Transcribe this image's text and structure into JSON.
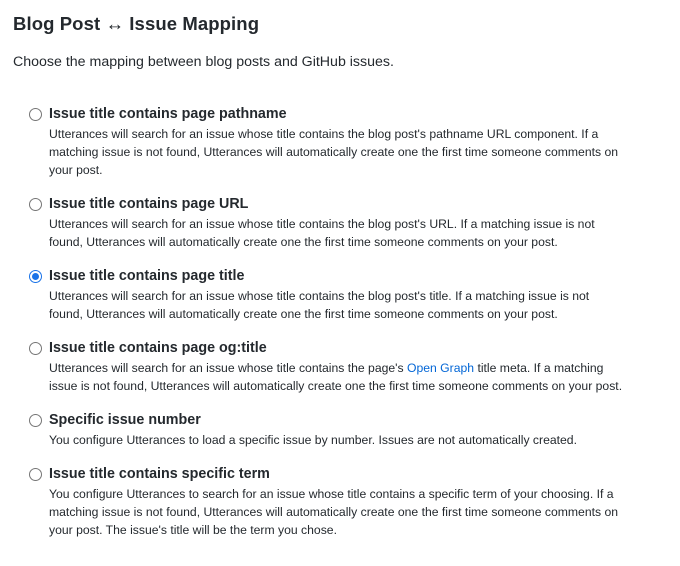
{
  "section": {
    "title": "Blog Post ↔ Issue Mapping",
    "description": "Choose the mapping between blog posts and GitHub issues."
  },
  "options": [
    {
      "label": "Issue title contains page pathname",
      "checked": false,
      "help_lines": [
        "Utterances will search for an issue whose title contains the blog post's pathname URL component. If a",
        "matching issue is not found, Utterances will automatically create one the first time someone comments on",
        "your post."
      ]
    },
    {
      "label": "Issue title contains page URL",
      "checked": false,
      "help_lines": [
        "Utterances will search for an issue whose title contains the blog post's URL. If a matching issue is not",
        "found, Utterances will automatically create one the first time someone comments on your post."
      ]
    },
    {
      "label": "Issue title contains page title",
      "checked": true,
      "help_lines": [
        "Utterances will search for an issue whose title contains the blog post's title. If a matching issue is not",
        "found, Utterances will automatically create one the first time someone comments on your post."
      ]
    },
    {
      "label": "Issue title contains page og:title",
      "checked": false,
      "help_before_link": "Utterances will search for an issue whose title contains the page's ",
      "help_link": "Open Graph",
      "help_after_link": " title meta. If a matching",
      "help_lines": [
        "issue is not found, Utterances will automatically create one the first time someone comments on your post."
      ]
    },
    {
      "label": "Specific issue number",
      "checked": false,
      "help_lines": [
        "You configure Utterances to load a specific issue by number. Issues are not automatically created."
      ]
    },
    {
      "label": "Issue title contains specific term",
      "checked": false,
      "help_lines": [
        "You configure Utterances to search for an issue whose title contains a specific term of your choosing. If a",
        "matching issue is not found, Utterances will automatically create one the first time someone comments on",
        "your post. The issue's title will be the term you chose."
      ]
    }
  ],
  "colors": {
    "text": "#24292e",
    "link": "#0366d6",
    "radio_checked": "#1a73e8",
    "radio_border": "#767676"
  }
}
